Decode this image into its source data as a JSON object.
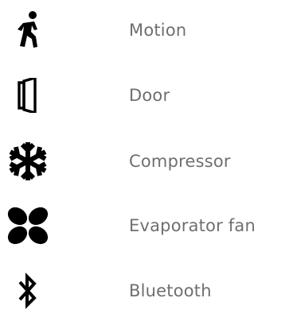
{
  "legend": {
    "items": [
      {
        "icon": "motion-icon",
        "label": "Motion"
      },
      {
        "icon": "door-icon",
        "label": "Door"
      },
      {
        "icon": "snowflake-icon",
        "label": "Compressor"
      },
      {
        "icon": "fan-icon",
        "label": "Evaporator fan"
      },
      {
        "icon": "bluetooth-icon",
        "label": "Bluetooth"
      }
    ]
  },
  "colors": {
    "icon": "#000000",
    "label": "#6f6f6f",
    "background": "#ffffff"
  }
}
